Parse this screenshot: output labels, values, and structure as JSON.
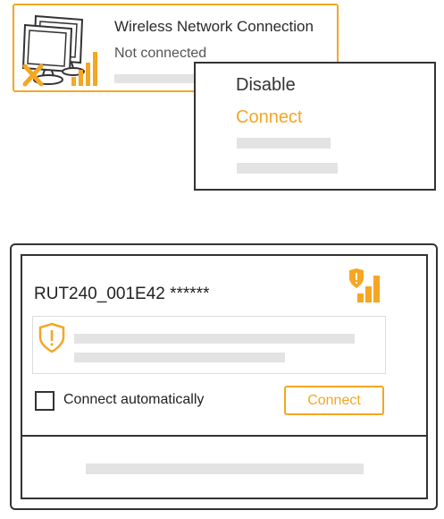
{
  "colors": {
    "accent": "#f5a623",
    "border": "#333333",
    "placeholder": "#e3e3e3"
  },
  "adapter": {
    "title": "Wireless Network Connection",
    "status": "Not connected",
    "icon": "monitors-disconnected-icon",
    "signal_icon": "signal-bars-icon"
  },
  "context_menu": {
    "items": [
      {
        "label": "Disable"
      },
      {
        "label": "Connect"
      }
    ]
  },
  "network_panel": {
    "ssid": "RUT240_001E42 ******",
    "signal_icon": "secured-signal-bars-icon",
    "warning_icon": "shield-warning-icon",
    "auto_connect_label": "Connect automatically",
    "auto_connect_checked": false,
    "connect_label": "Connect"
  }
}
